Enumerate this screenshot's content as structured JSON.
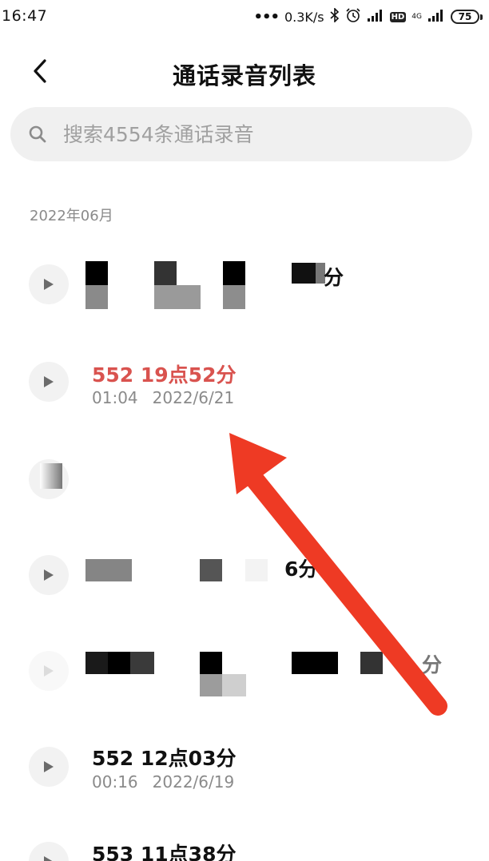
{
  "status_bar": {
    "time": "16:47",
    "dots": "•••",
    "net_speed": "0.3K/s",
    "hd": "HD",
    "net_type": "4G",
    "battery": "75"
  },
  "header": {
    "title": "通话录音列表",
    "back_icon": "chevron-left-icon"
  },
  "search": {
    "placeholder": "搜索4554条通话录音",
    "icon": "search-icon"
  },
  "section": {
    "date": "2022年06月"
  },
  "recordings": [
    {
      "title": "分",
      "duration": "",
      "date": "",
      "obscured": true
    },
    {
      "title": "552 19点52分",
      "duration": "01:04",
      "date": "2022/6/21",
      "highlighted": true,
      "highlight_color": "#d9534f"
    },
    {
      "title": "",
      "duration": "",
      "date": "",
      "obscured": true
    },
    {
      "title": "6分",
      "duration": "",
      "date": "",
      "obscured": true
    },
    {
      "title": "分",
      "duration": "",
      "date": "",
      "obscured": true
    },
    {
      "title": "552 12点03分",
      "duration": "00:16",
      "date": "2022/6/19"
    },
    {
      "title": "553 11点38分",
      "duration": "",
      "date": ""
    }
  ],
  "annotation": {
    "arrow_color": "#ee3a24"
  }
}
